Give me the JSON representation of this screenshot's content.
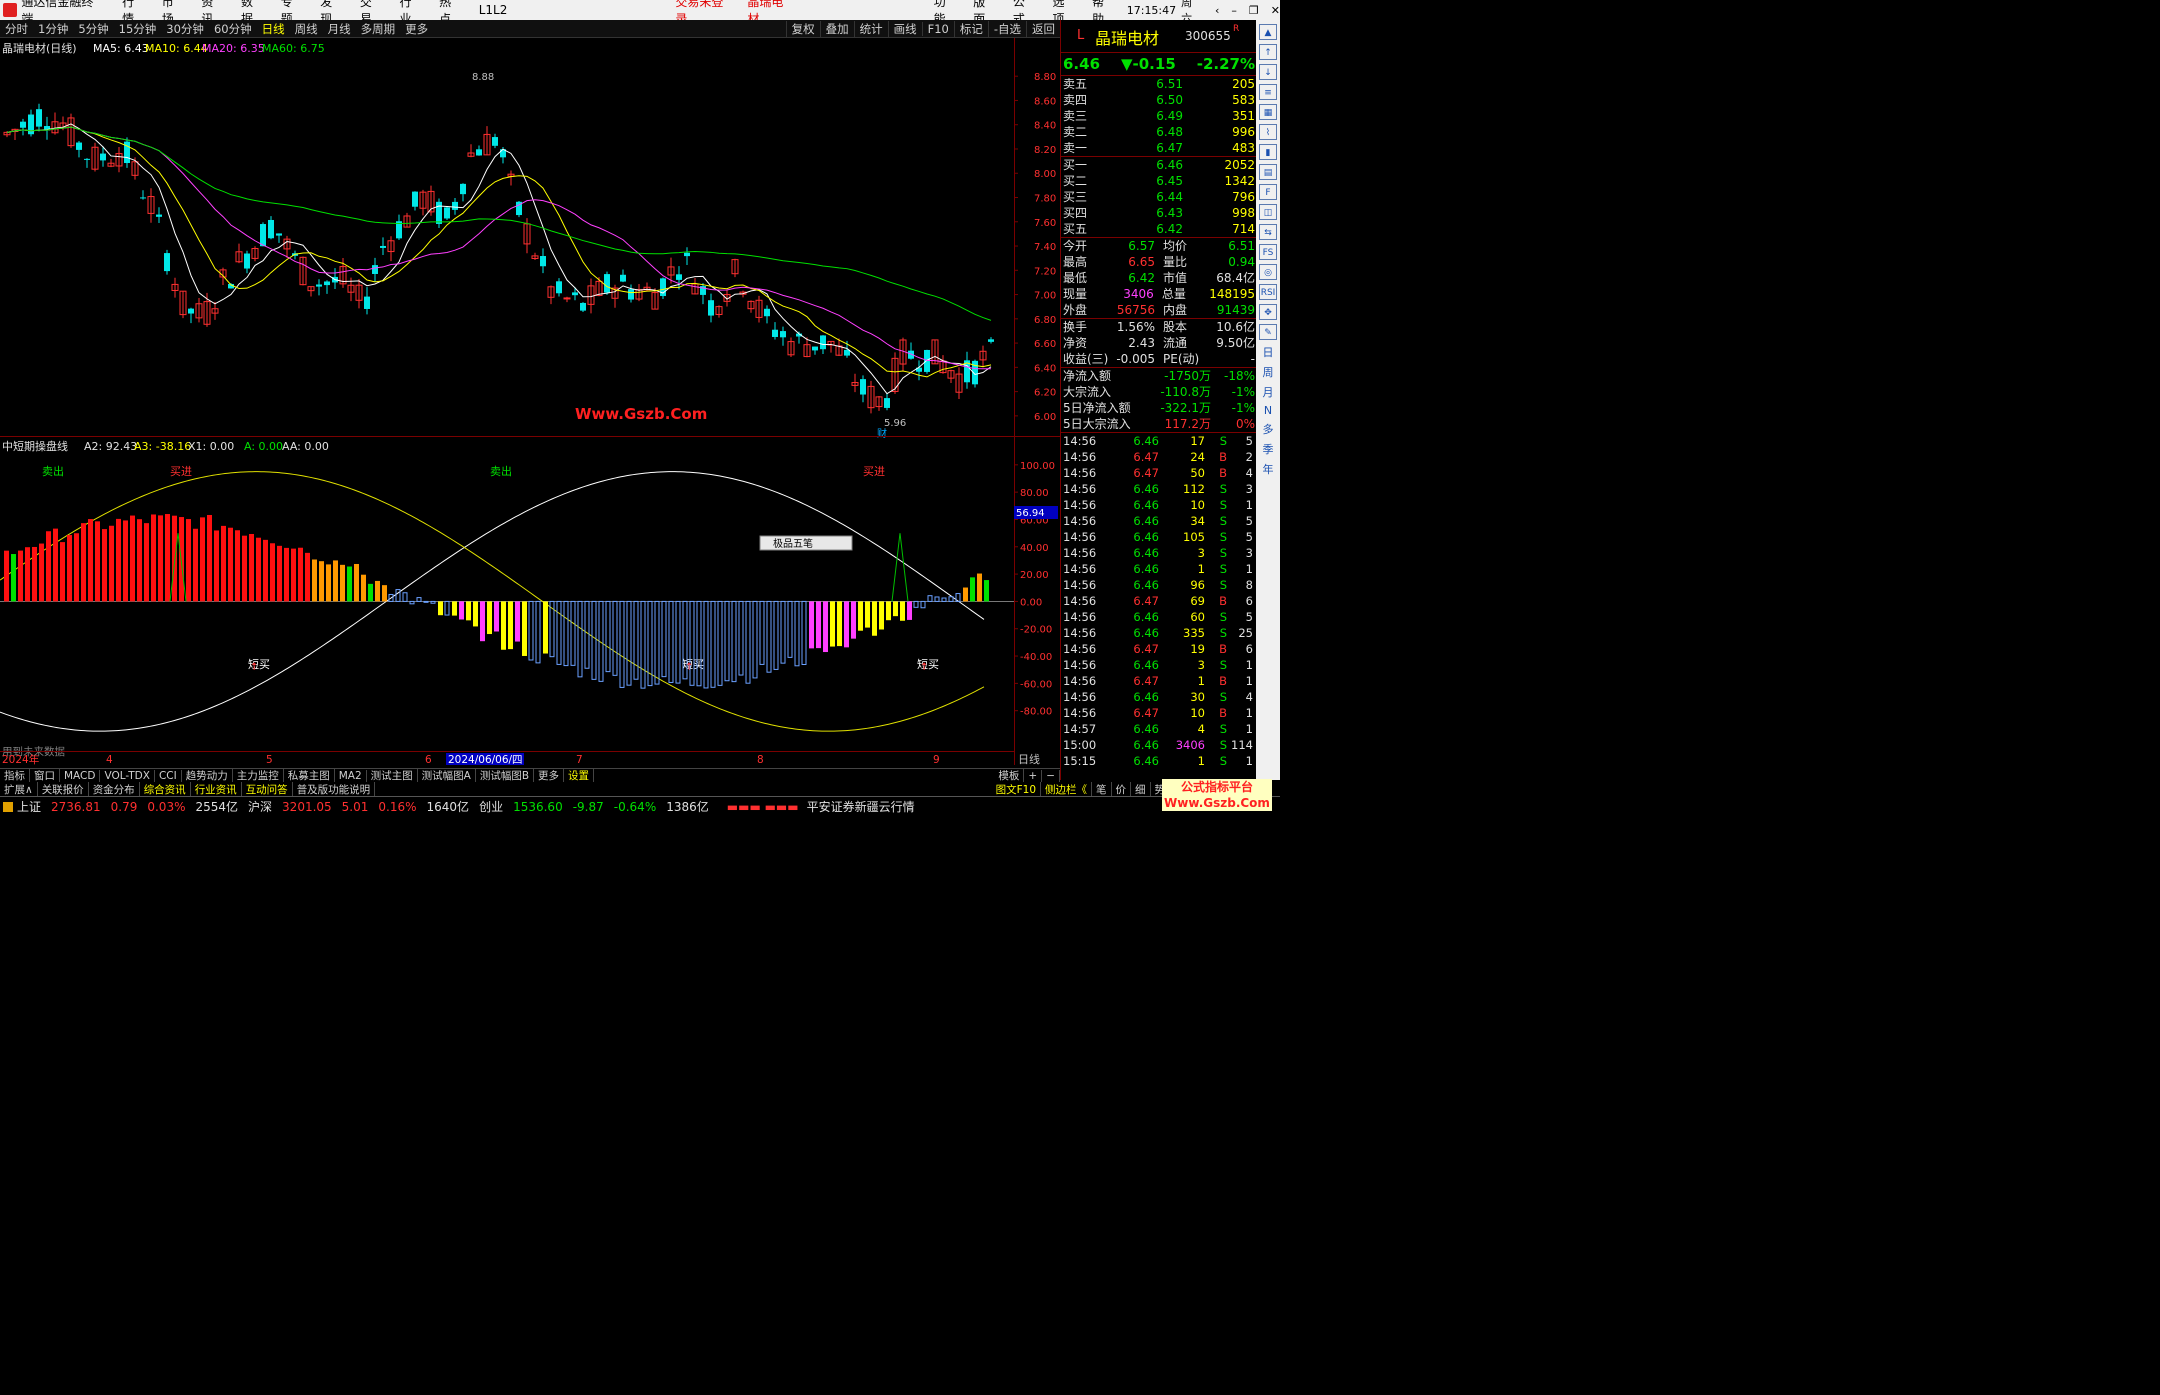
{
  "menubar": {
    "app": "通达信金融终端",
    "items": [
      "行情",
      "市场",
      "资讯",
      "数据",
      "专题",
      "发现",
      "交易",
      "行业",
      "热点",
      "L1L2"
    ],
    "login": "交易未登录",
    "stock": "晶瑞电材",
    "right_items": [
      "功能",
      "版面",
      "公式",
      "选项",
      "帮助"
    ],
    "time": "17:15:47",
    "weekday": "周六"
  },
  "periods": [
    "分时",
    "1分钟",
    "5分钟",
    "15分钟",
    "30分钟",
    "60分钟",
    "日线",
    "周线",
    "月线",
    "多周期",
    "更多"
  ],
  "active_period": "日线",
  "tools": [
    "复权",
    "叠加",
    "统计",
    "画线",
    "F10",
    "标记",
    "-自选",
    "返回"
  ],
  "kline": {
    "legend_name": "晶瑞电材(日线)",
    "ma5": "MA5: 6.43",
    "ma10": "MA10: 6.44",
    "ma20": "MA20: 6.35",
    "ma60": "MA60: 6.75",
    "high_label": "8.88",
    "low_label": "5.96",
    "watermark": "Www.Gszb.Com",
    "cai": "财",
    "y_ticks": [
      "8.80",
      "8.60",
      "8.40",
      "8.20",
      "8.00",
      "7.80",
      "7.60",
      "7.40",
      "7.20",
      "7.00",
      "6.80",
      "6.60",
      "6.40",
      "6.20",
      "6.00"
    ]
  },
  "indicator": {
    "name": "中短期操盘线",
    "a2": "A2: 92.43",
    "a3": "A3: -38.16",
    "x1": "X1: 0.00",
    "a": "A: 0.00",
    "aa": "AA: 0.00",
    "sell_label": "卖出",
    "buy_label": "买进",
    "short_buy": "短买",
    "future_data": "用到未来数据",
    "cursor_value": "56.94",
    "y_ticks": [
      "100.00",
      "80.00",
      "60.00",
      "40.00",
      "20.00",
      "0.00",
      "-20.00",
      "-40.00",
      "-60.00",
      "-80.00"
    ],
    "popup": "极品五笔"
  },
  "xaxis": {
    "labels": [
      "2024年",
      "4",
      "5",
      "6",
      "2024/06/06/四",
      "7",
      "8",
      "9"
    ],
    "right": "日线"
  },
  "quote": {
    "code_prefix": "L",
    "name": "晶瑞电材",
    "code": "300655",
    "r": "R",
    "price": "6.46",
    "change": "▼-0.15",
    "pct": "-2.27%"
  },
  "asks": [
    {
      "l": "卖五",
      "p": "6.51",
      "v": "205"
    },
    {
      "l": "卖四",
      "p": "6.50",
      "v": "583"
    },
    {
      "l": "卖三",
      "p": "6.49",
      "v": "351"
    },
    {
      "l": "卖二",
      "p": "6.48",
      "v": "996"
    },
    {
      "l": "卖一",
      "p": "6.47",
      "v": "483"
    }
  ],
  "bids": [
    {
      "l": "买一",
      "p": "6.46",
      "v": "2052"
    },
    {
      "l": "买二",
      "p": "6.45",
      "v": "1342"
    },
    {
      "l": "买三",
      "p": "6.44",
      "v": "796"
    },
    {
      "l": "买四",
      "p": "6.43",
      "v": "998"
    },
    {
      "l": "买五",
      "p": "6.42",
      "v": "714"
    }
  ],
  "stats": [
    [
      "今开",
      "6.57",
      "均价",
      "6.51"
    ],
    [
      "最高",
      "6.65",
      "量比",
      "0.94"
    ],
    [
      "最低",
      "6.42",
      "市值",
      "68.4亿"
    ],
    [
      "现量",
      "3406",
      "总量",
      "148195"
    ],
    [
      "外盘",
      "56756",
      "内盘",
      "91439"
    ]
  ],
  "stats2": [
    [
      "换手",
      "1.56%",
      "股本",
      "10.6亿"
    ],
    [
      "净资",
      "2.43",
      "流通",
      "9.50亿"
    ],
    [
      "收益(三)",
      "-0.005",
      "PE(动)",
      "-"
    ]
  ],
  "flows": [
    [
      "净流入额",
      "-1750万",
      "-18%"
    ],
    [
      "大宗流入",
      "-110.8万",
      "-1%"
    ],
    [
      "5日净流入额",
      "-322.1万",
      "-1%"
    ],
    [
      "5日大宗流入",
      "117.2万",
      "0%"
    ]
  ],
  "ticks": [
    [
      "14:56",
      "6.46",
      "17",
      "S",
      "5"
    ],
    [
      "14:56",
      "6.47",
      "24",
      "B",
      "2"
    ],
    [
      "14:56",
      "6.47",
      "50",
      "B",
      "4"
    ],
    [
      "14:56",
      "6.46",
      "112",
      "S",
      "3"
    ],
    [
      "14:56",
      "6.46",
      "10",
      "S",
      "1"
    ],
    [
      "14:56",
      "6.46",
      "34",
      "S",
      "5"
    ],
    [
      "14:56",
      "6.46",
      "105",
      "S",
      "5"
    ],
    [
      "14:56",
      "6.46",
      "3",
      "S",
      "3"
    ],
    [
      "14:56",
      "6.46",
      "1",
      "S",
      "1"
    ],
    [
      "14:56",
      "6.46",
      "96",
      "S",
      "8"
    ],
    [
      "14:56",
      "6.47",
      "69",
      "B",
      "6"
    ],
    [
      "14:56",
      "6.46",
      "60",
      "S",
      "5"
    ],
    [
      "14:56",
      "6.46",
      "335",
      "S",
      "25"
    ],
    [
      "14:56",
      "6.47",
      "19",
      "B",
      "6"
    ],
    [
      "14:56",
      "6.46",
      "3",
      "S",
      "1"
    ],
    [
      "14:56",
      "6.47",
      "1",
      "B",
      "1"
    ],
    [
      "14:56",
      "6.46",
      "30",
      "S",
      "4"
    ],
    [
      "14:56",
      "6.47",
      "10",
      "B",
      "1"
    ],
    [
      "14:57",
      "6.46",
      "4",
      "S",
      "1"
    ],
    [
      "15:00",
      "6.46",
      "3406",
      "S",
      "114"
    ],
    [
      "15:15",
      "6.46",
      "1",
      "S",
      "1"
    ]
  ],
  "bottom_tabs": [
    "指标",
    "窗口",
    "MACD",
    "VOL-TDX",
    "CCI",
    "趋势动力",
    "主力监控",
    "私募主图",
    "MA2",
    "测试主图",
    "测试幅图A",
    "测试幅图B",
    "更多",
    "设置"
  ],
  "bottom_right": "模板",
  "bottom_tabs2": [
    "扩展∧",
    "关联报价",
    "资金分布",
    "综合资讯",
    "行业资讯",
    "互动问答",
    "普及版功能说明"
  ],
  "bottom_right2": [
    "图文F10",
    "侧边栏《",
    "笔",
    "价",
    "细",
    "势"
  ],
  "indices": [
    {
      "n": "上证",
      "v": "2736.81",
      "c": "0.79",
      "p": "0.03%",
      "a": "2554亿"
    },
    {
      "n": "沪深",
      "v": "3201.05",
      "c": "5.01",
      "p": "0.16%",
      "a": "1640亿"
    },
    {
      "n": "创业",
      "v": "1536.60",
      "c": "-9.87",
      "p": "-0.64%",
      "a": "1386亿"
    }
  ],
  "broker": "平安证券新疆云行情",
  "brand": "公式指标平台 Www.Gszb.Com",
  "colors": {
    "up": "#ff3030",
    "down": "#00e000",
    "ma5": "#ffffff",
    "ma10": "#ffff00",
    "ma20": "#ff40ff",
    "ma60": "#00e000"
  },
  "toolbar_right": [
    "日",
    "周",
    "月",
    "N",
    "多",
    "季",
    "年"
  ]
}
